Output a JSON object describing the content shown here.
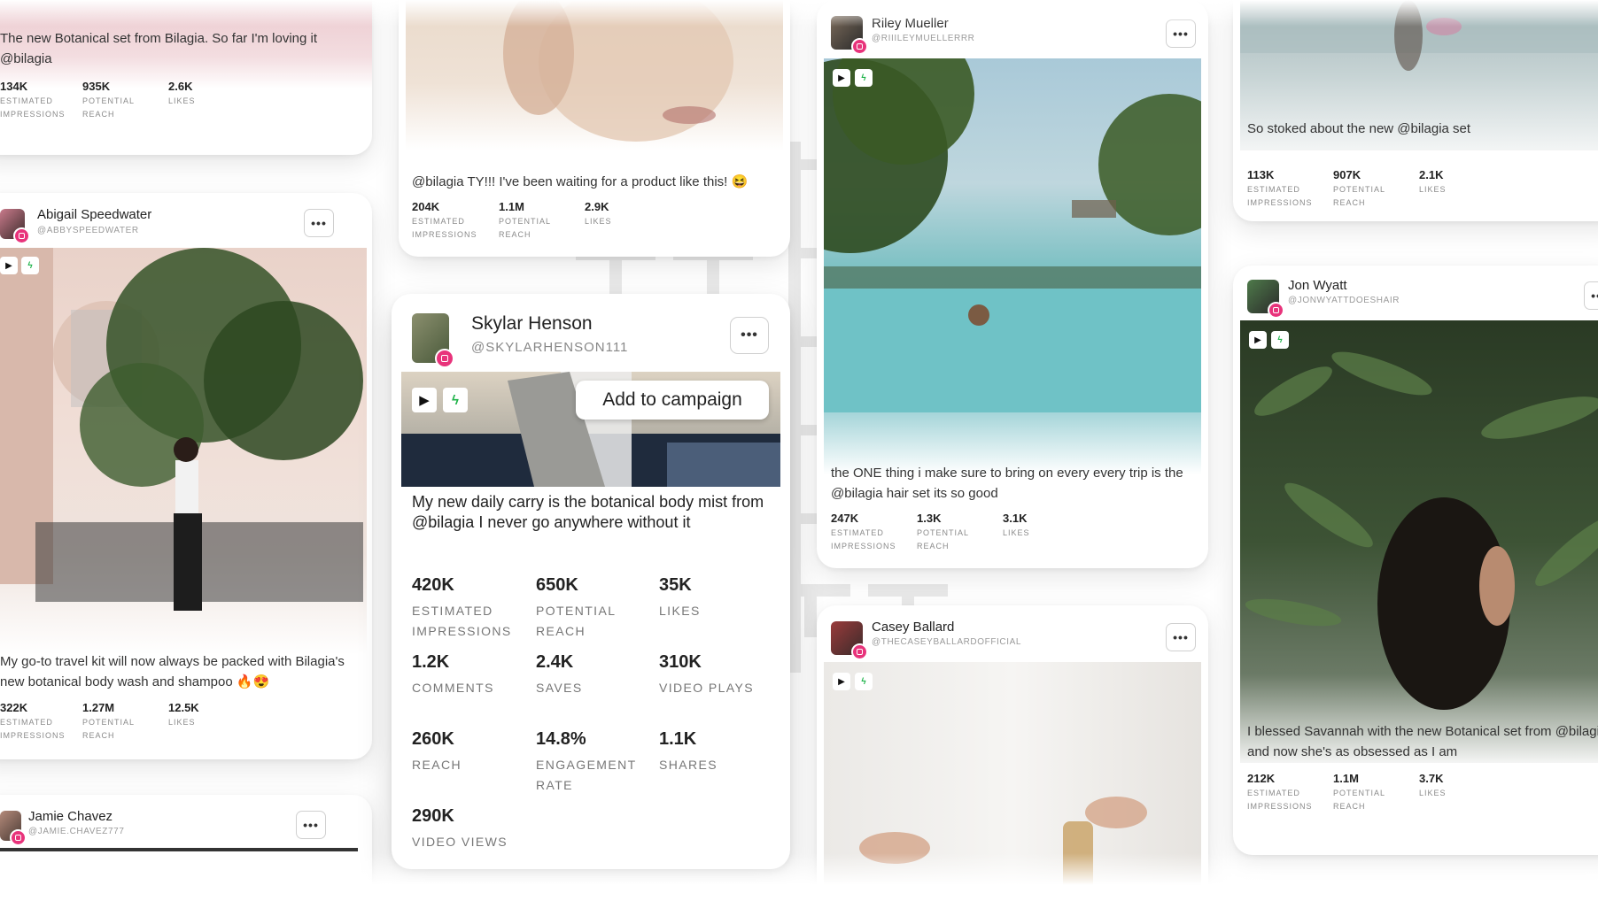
{
  "colors": {
    "accent_instagram": "#e8337b",
    "bolt_green": "#1fb34a"
  },
  "cards": {
    "c1": {
      "caption": "The new Botanical set from Bilagia. So far I'm loving it @bilagia",
      "stats": [
        {
          "value": "134K",
          "label": "ESTIMATED IMPRESSIONS"
        },
        {
          "value": "935K",
          "label": "POTENTIAL REACH"
        },
        {
          "value": "2.6K",
          "label": "LIKES"
        }
      ]
    },
    "c2": {
      "name": "Abigail Speedwater",
      "handle": "@ABBYSPEEDWATER",
      "caption": "My go-to travel kit will now always be packed with Bilagia's new botanical body wash and shampoo 🔥😍",
      "stats": [
        {
          "value": "322K",
          "label": "ESTIMATED IMPRESSIONS"
        },
        {
          "value": "1.27M",
          "label": "POTENTIAL REACH"
        },
        {
          "value": "12.5K",
          "label": "LIKES"
        }
      ]
    },
    "c3": {
      "name": "Jamie Chavez",
      "handle": "@JAMIE.CHAVEZ777"
    },
    "c4": {
      "caption": "@bilagia TY!!! I've been waiting for a product like this! 😆",
      "stats": [
        {
          "value": "204K",
          "label": "ESTIMATED IMPRESSIONS"
        },
        {
          "value": "1.1M",
          "label": "POTENTIAL REACH"
        },
        {
          "value": "2.9K",
          "label": "LIKES"
        }
      ]
    },
    "c5": {
      "name": "Skylar Henson",
      "handle": "@SKYLARHENSON111",
      "add_button": "Add to campaign",
      "caption": "My new daily carry is the botanical body mist from @bilagia I never go anywhere without it",
      "stats": [
        {
          "value": "420K",
          "label": "ESTIMATED IMPRESSIONS"
        },
        {
          "value": "650K",
          "label": "POTENTIAL REACH"
        },
        {
          "value": "35K",
          "label": "LIKES"
        },
        {
          "value": "1.2K",
          "label": "COMMENTS"
        },
        {
          "value": "2.4K",
          "label": "SAVES"
        },
        {
          "value": "310K",
          "label": "VIDEO PLAYS"
        },
        {
          "value": "260K",
          "label": "REACH"
        },
        {
          "value": "14.8%",
          "label": "ENGAGEMENT RATE"
        },
        {
          "value": "1.1K",
          "label": "SHARES"
        },
        {
          "value": "290K",
          "label": "VIDEO VIEWS"
        }
      ]
    },
    "c6": {
      "name": "Riley Mueller",
      "handle": "@RIIILEYMUELLERRR",
      "caption": "the ONE thing i make sure to bring on every every trip is the @bilagia hair set its so good",
      "stats": [
        {
          "value": "247K",
          "label": "ESTIMATED IMPRESSIONS"
        },
        {
          "value": "1.3K",
          "label": "POTENTIAL REACH"
        },
        {
          "value": "3.1K",
          "label": "LIKES"
        }
      ]
    },
    "c7": {
      "name": "Casey Ballard",
      "handle": "@THECASEYBALLARDOFFICIAL"
    },
    "c8": {
      "caption": "So stoked about the new @bilagia set",
      "stats": [
        {
          "value": "113K",
          "label": "ESTIMATED IMPRESSIONS"
        },
        {
          "value": "907K",
          "label": "POTENTIAL REACH"
        },
        {
          "value": "2.1K",
          "label": "LIKES"
        }
      ]
    },
    "c9": {
      "name": "Jon Wyatt",
      "handle": "@JONWYATTDOESHAIR",
      "caption": "I blessed Savannah with the new Botanical set from @bilagia and now she's as obsessed as I am",
      "stats": [
        {
          "value": "212K",
          "label": "ESTIMATED IMPRESSIONS"
        },
        {
          "value": "1.1M",
          "label": "POTENTIAL REACH"
        },
        {
          "value": "3.7K",
          "label": "LIKES"
        }
      ]
    }
  }
}
